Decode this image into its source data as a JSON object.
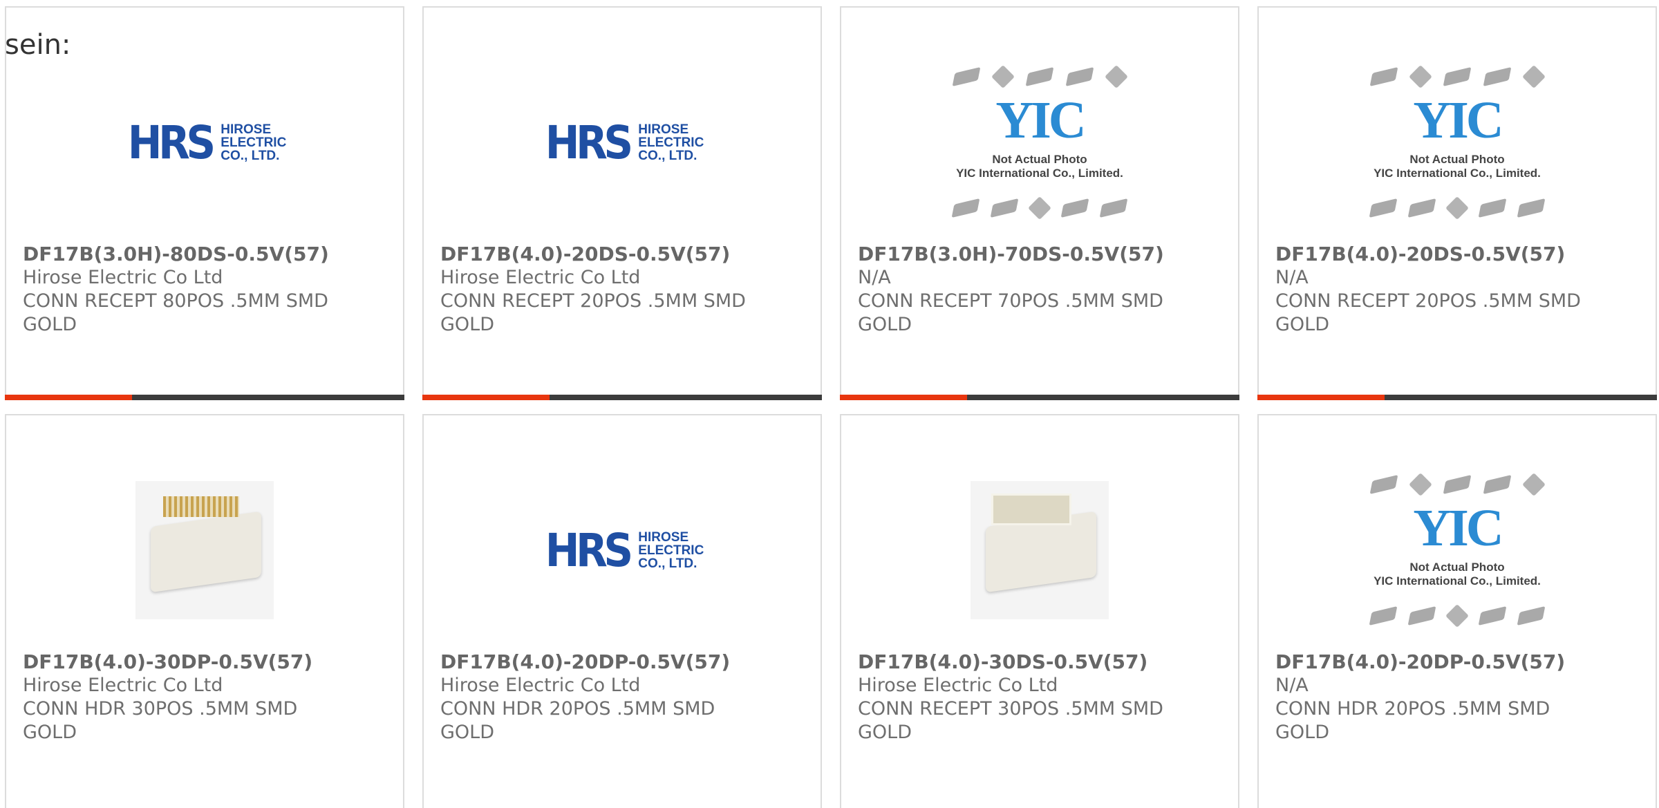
{
  "intro_text": "sein:",
  "colors": {
    "accent": "#e8360f",
    "bar": "#3c3c3c",
    "hrs_blue": "#1f4fa3",
    "yic_blue": "#2b8bd3"
  },
  "hrs_logo": {
    "mark": "HRS",
    "line1": "HIROSE",
    "line2": "ELECTRIC",
    "line3": "CO., LTD."
  },
  "yic_logo": {
    "mark": "YIC",
    "cap1": "Not Actual Photo",
    "cap2": "YIC International Co., Limited."
  },
  "products": [
    {
      "part": "DF17B(3.0H)-80DS-0.5V(57)",
      "maker": "Hirose Electric Co Ltd",
      "desc1": "CONN RECEPT 80POS .5MM SMD",
      "desc2": "GOLD",
      "image": "hrs-logo"
    },
    {
      "part": "DF17B(4.0)-20DS-0.5V(57)",
      "maker": "Hirose Electric Co Ltd",
      "desc1": "CONN RECEPT 20POS .5MM SMD",
      "desc2": "GOLD",
      "image": "hrs-logo"
    },
    {
      "part": "DF17B(3.0H)-70DS-0.5V(57)",
      "maker": "N/A",
      "desc1": "CONN RECEPT 70POS .5MM SMD",
      "desc2": "GOLD",
      "image": "yic-placeholder"
    },
    {
      "part": "DF17B(4.0)-20DS-0.5V(57)",
      "maker": "N/A",
      "desc1": "CONN RECEPT 20POS .5MM SMD",
      "desc2": "GOLD",
      "image": "yic-placeholder"
    },
    {
      "part": "DF17B(4.0)-30DP-0.5V(57)",
      "maker": "Hirose Electric Co Ltd",
      "desc1": "CONN HDR 30POS .5MM SMD",
      "desc2": "GOLD",
      "image": "connector-photo"
    },
    {
      "part": "DF17B(4.0)-20DP-0.5V(57)",
      "maker": "Hirose Electric Co Ltd",
      "desc1": "CONN HDR 20POS .5MM SMD",
      "desc2": "GOLD",
      "image": "hrs-logo"
    },
    {
      "part": "DF17B(4.0)-30DS-0.5V(57)",
      "maker": "Hirose Electric Co Ltd",
      "desc1": "CONN RECEPT 30POS .5MM SMD",
      "desc2": "GOLD",
      "image": "connector-photo"
    },
    {
      "part": "DF17B(4.0)-20DP-0.5V(57)",
      "maker": "N/A",
      "desc1": "CONN HDR 20POS .5MM SMD",
      "desc2": "GOLD",
      "image": "yic-placeholder"
    }
  ]
}
